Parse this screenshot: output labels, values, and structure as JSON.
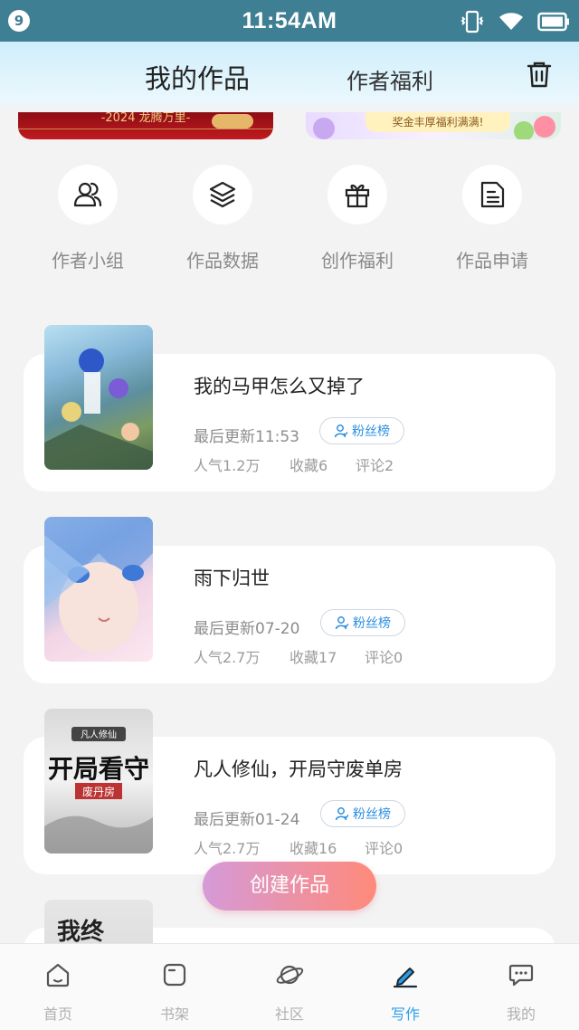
{
  "status_bar": {
    "notification_count": "9",
    "time": "11:54AM",
    "icons": [
      "vibrate-icon",
      "wifi-icon",
      "battery-icon"
    ]
  },
  "header": {
    "tab_mine": "我的作品",
    "tab_benefit": "作者福利",
    "trash_icon": "trash-icon"
  },
  "banners": {
    "left_text": "-2024 龙腾万里-",
    "right_text": "奖金丰厚福利满满!"
  },
  "quick_actions": [
    {
      "label": "作者小组",
      "icon": "group-icon"
    },
    {
      "label": "作品数据",
      "icon": "layers-icon"
    },
    {
      "label": "创作福利",
      "icon": "gift-icon"
    },
    {
      "label": "作品申请",
      "icon": "document-icon"
    }
  ],
  "works": [
    {
      "title": "我的马甲怎么又掉了",
      "update": "最后更新11:53",
      "fan_label": "粉丝榜",
      "popularity": "人气1.2万",
      "favorites": "收藏6",
      "comments": "评论2"
    },
    {
      "title": "雨下归世",
      "update": "最后更新07-20",
      "fan_label": "粉丝榜",
      "popularity": "人气2.7万",
      "favorites": "收藏17",
      "comments": "评论0"
    },
    {
      "title": "凡人修仙，开局守废单房",
      "update": "最后更新01-24",
      "fan_label": "粉丝榜",
      "popularity": "人气2.7万",
      "favorites": "收藏16",
      "comments": "评论0",
      "cover_text_top": "凡人修仙",
      "cover_text_main": "开局看守",
      "cover_text_sub": "废丹房"
    },
    {
      "cover_text_main": "我终"
    }
  ],
  "create_button": "创建作品",
  "bottom_nav": [
    {
      "label": "首页",
      "icon": "home-icon",
      "active": false
    },
    {
      "label": "书架",
      "icon": "bookshelf-icon",
      "active": false
    },
    {
      "label": "社区",
      "icon": "planet-icon",
      "active": false
    },
    {
      "label": "写作",
      "icon": "pen-icon",
      "active": true
    },
    {
      "label": "我的",
      "icon": "chat-bubble-icon",
      "active": false
    }
  ],
  "colors": {
    "status_bar": "#3f7f93",
    "accent_blue": "#2a9fe8",
    "create_gradient_start": "#d59ad8",
    "create_gradient_end": "#ff8a7a"
  }
}
